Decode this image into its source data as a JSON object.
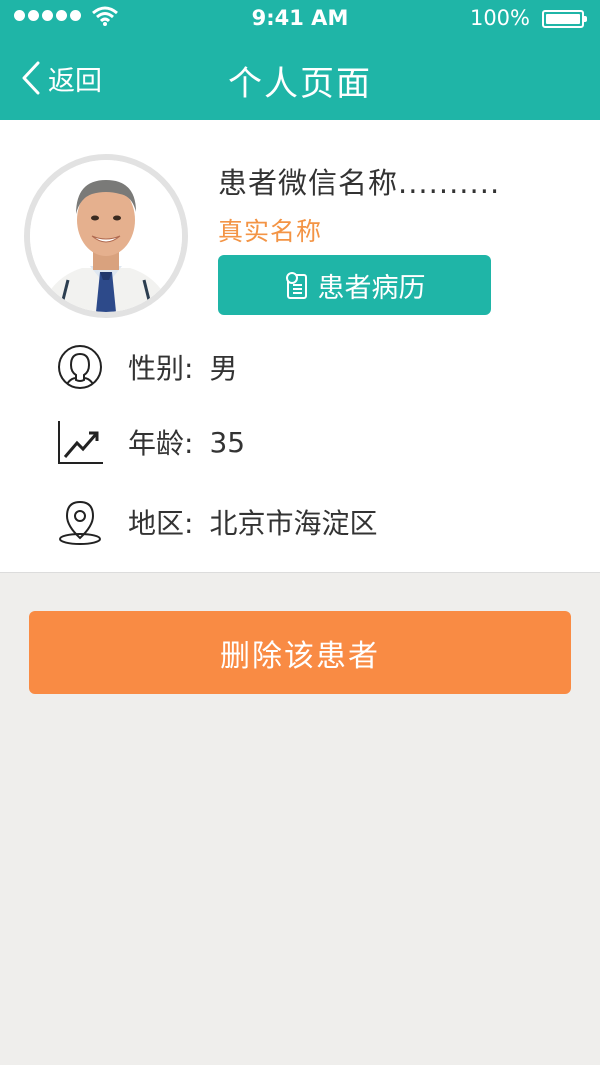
{
  "status_bar": {
    "time": "9:41 AM",
    "battery": "100%"
  },
  "header": {
    "back_label": "返回",
    "title": "个人页面"
  },
  "profile": {
    "nickname": "患者微信名称..........",
    "real_name": "真实名称",
    "record_button": "患者病历"
  },
  "info": {
    "gender_label": "性别:",
    "gender_value": "男",
    "age_label": "年龄:",
    "age_value": "35",
    "region_label": "地区:",
    "region_value": "北京市海淀区"
  },
  "actions": {
    "delete_label": "删除该患者"
  },
  "colors": {
    "primary": "#1fb5a7",
    "accent": "#f98b44",
    "real_name": "#f39445"
  }
}
